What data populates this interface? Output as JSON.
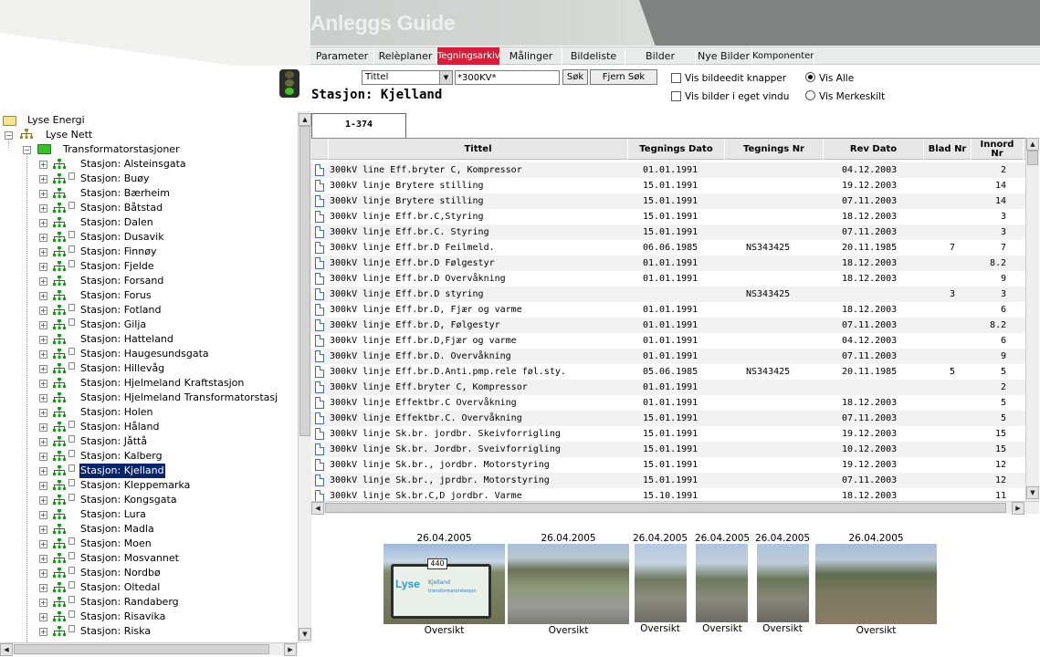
{
  "app": {
    "title": "Anleggs Guide"
  },
  "nav": {
    "tabs": [
      {
        "label": "Parameter",
        "active": false
      },
      {
        "label": "Relèplaner",
        "active": false
      },
      {
        "label": "Tegningsarkiv",
        "active": true
      },
      {
        "label": "Målinger",
        "active": false
      },
      {
        "label": "Bildeliste",
        "active": false
      },
      {
        "label": "Bilder",
        "active": false
      },
      {
        "label": "Nye Bilder",
        "active": false
      },
      {
        "label": "Komponenter",
        "active": false
      }
    ]
  },
  "colors": {
    "active_tab": "#d31f3a",
    "tree_selected": "#0a246a",
    "traffic_green": "#3fbf24"
  },
  "search": {
    "field_select": "Tittel",
    "query": "*300KV*",
    "search_button": "Søk",
    "clear_button": "Fjern Søk",
    "opt_edit_buttons": "Vis bildeedit knapper",
    "opt_edit_buttons_checked": false,
    "opt_own_window": "Vis bilder i eget vindu",
    "opt_own_window_checked": false,
    "radio_all": "Vis Alle",
    "radio_all_checked": true,
    "radio_markers": "Vis Merkeskilt",
    "radio_markers_checked": false
  },
  "station_heading": "Stasjon: Kjelland",
  "tree": {
    "root": "Lyse Energi",
    "net": "Lyse Nett",
    "group": "Transformatorstasjoner",
    "selected": "Stasjon: Kjelland",
    "stations": [
      "Stasjon: Alsteinsgata",
      "Stasjon: Buøy",
      "Stasjon: Bærheim",
      "Stasjon: Båtstad",
      "Stasjon: Dalen",
      "Stasjon: Dusavik",
      "Stasjon: Finnøy",
      "Stasjon: Fjelde",
      "Stasjon: Forsand",
      "Stasjon: Forus",
      "Stasjon: Fotland",
      "Stasjon: Gilja",
      "Stasjon: Hatteland",
      "Stasjon: Haugesundsgata",
      "Stasjon: Hillevåg",
      "Stasjon: Hjelmeland Kraftstasjon",
      "Stasjon: Hjelmeland Transformatorstasj",
      "Stasjon: Holen",
      "Stasjon: Håland",
      "Stasjon: Jåttå",
      "Stasjon: Kalberg",
      "Stasjon: Kjelland",
      "Stasjon: Kleppemarka",
      "Stasjon: Kongsgata",
      "Stasjon: Lura",
      "Stasjon: Madla",
      "Stasjon: Moen",
      "Stasjon: Mosvannet",
      "Stasjon: Nordbø",
      "Stasjon: Oltedal",
      "Stasjon: Randaberg",
      "Stasjon: Risavika",
      "Stasjon: Riska"
    ],
    "has_doc": [
      false,
      true,
      false,
      true,
      false,
      true,
      true,
      true,
      false,
      false,
      true,
      true,
      false,
      true,
      true,
      false,
      false,
      false,
      true,
      true,
      true,
      true,
      true,
      true,
      false,
      false,
      true,
      true,
      true,
      true,
      true,
      true,
      true
    ]
  },
  "range_tab": "1-374",
  "table": {
    "headers": [
      "Tittel",
      "Tegnings Dato",
      "Tegnings Nr",
      "Rev Dato",
      "Blad Nr",
      "Innord Nr"
    ],
    "rows": [
      [
        "300kV line Eff.bryter C, Kompressor",
        "01.01.1991",
        "",
        "04.12.2003",
        "",
        "2"
      ],
      [
        "300kV linje Brytere stilling",
        "15.01.1991",
        "",
        "19.12.2003",
        "",
        "14"
      ],
      [
        "300kV linje Brytere stilling",
        "15.01.1991",
        "",
        "07.11.2003",
        "",
        "14"
      ],
      [
        "300kV linje Eff.br.C,Styring",
        "15.01.1991",
        "",
        "18.12.2003",
        "",
        "3"
      ],
      [
        "300kV linje Eff.br.C. Styring",
        "15.01.1991",
        "",
        "07.11.2003",
        "",
        "3"
      ],
      [
        "300kV linje Eff.br.D Feilmeld.",
        "06.06.1985",
        "NS343425",
        "20.11.1985",
        "7",
        "7"
      ],
      [
        "300kV linje Eff.br.D Følgestyr",
        "01.01.1991",
        "",
        "18.12.2003",
        "",
        "8.2"
      ],
      [
        "300kV linje Eff.br.D Overvåkning",
        "01.01.1991",
        "",
        "18.12.2003",
        "",
        "9"
      ],
      [
        "300kV linje Eff.br.D styring",
        "",
        "NS343425",
        "",
        "3",
        "3"
      ],
      [
        "300kV linje Eff.br.D, Fjær og varme",
        "01.01.1991",
        "",
        "18.12.2003",
        "",
        "6"
      ],
      [
        "300kV linje Eff.br.D, Følgestyr",
        "01.01.1991",
        "",
        "07.11.2003",
        "",
        "8.2"
      ],
      [
        "300kV linje Eff.br.D,Fjær og varme",
        "01.01.1991",
        "",
        "04.12.2003",
        "",
        "6"
      ],
      [
        "300kV linje Eff.br.D. Overvåkning",
        "01.01.1991",
        "",
        "07.11.2003",
        "",
        "9"
      ],
      [
        "300kV linje Eff.br.D.Anti.pmp.rele føl.sty.",
        "05.06.1985",
        "NS343425",
        "20.11.1985",
        "5",
        "5"
      ],
      [
        "300kV linje Eff.bryter C, Kompressor",
        "01.01.1991",
        "",
        "",
        "",
        "2"
      ],
      [
        "300kV linje Effektbr.C Overvåkning",
        "01.01.1991",
        "",
        "18.12.2003",
        "",
        "5"
      ],
      [
        "300kV linje Effektbr.C. Overvåkning",
        "15.01.1991",
        "",
        "07.11.2003",
        "",
        "5"
      ],
      [
        "300kV linje Sk.br. jordbr. Skeivforrigling",
        "15.01.1991",
        "",
        "19.12.2003",
        "",
        "15"
      ],
      [
        "300kV linje Sk.br. Jordbr. Sveivforrigling",
        "15.01.1991",
        "",
        "10.12.2003",
        "",
        "15"
      ],
      [
        "300kV linje Sk.br., jordbr. Motorstyring",
        "15.01.1991",
        "",
        "19.12.2003",
        "",
        "12"
      ],
      [
        "300kV linje Sk.br., jprdbr. Motorstyring",
        "15.01.1991",
        "",
        "07.11.2003",
        "",
        "12"
      ],
      [
        "300kV linje Sk.br.C,D jordbr. Varme",
        "15.10.1991",
        "",
        "18.12.2003",
        "",
        "11"
      ]
    ]
  },
  "photos": [
    {
      "date": "26.04.2005",
      "caption": "Oversikt",
      "sign_number": "440",
      "sign_logo": "Lyse",
      "sign_line1": "Kjelland",
      "sign_line2": "transformatorstasjon"
    },
    {
      "date": "26.04.2005",
      "caption": "Oversikt"
    },
    {
      "date": "26.04.2005",
      "caption": "Oversikt"
    },
    {
      "date": "26.04.2005",
      "caption": "Oversikt"
    },
    {
      "date": "26.04.2005",
      "caption": "Oversikt"
    },
    {
      "date": "26.04.2005",
      "caption": "Oversikt"
    }
  ]
}
